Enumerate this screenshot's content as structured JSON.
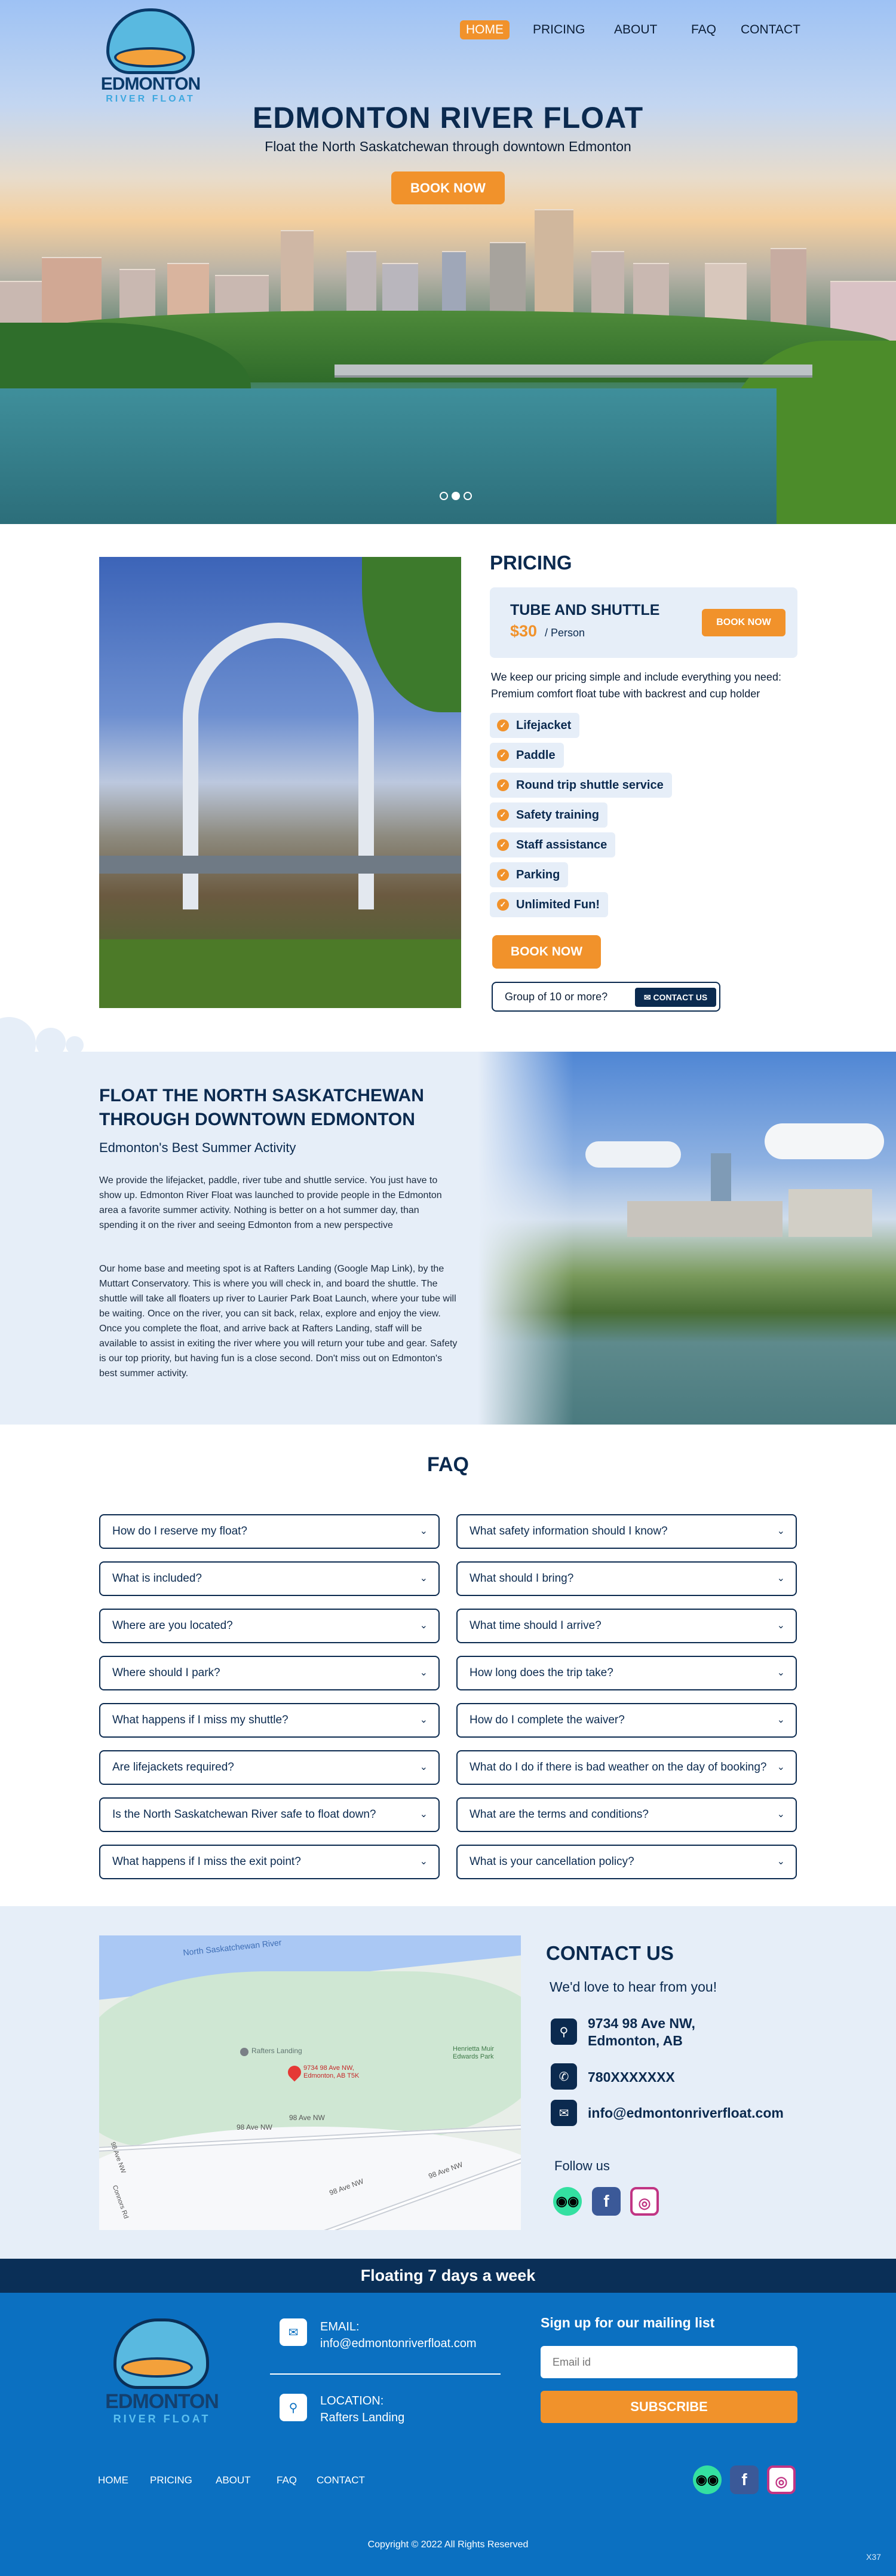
{
  "header": {
    "logo_line1": "EDMONTON",
    "logo_line2": "RIVER FLOAT",
    "nav": [
      "HOME",
      "PRICING",
      "ABOUT",
      "FAQ",
      "CONTACT"
    ]
  },
  "hero": {
    "title": "EDMONTON RIVER FLOAT",
    "subtitle": "Float the North Saskatchewan through downtown Edmonton",
    "cta": "BOOK NOW"
  },
  "pricing": {
    "title": "PRICING",
    "card_title": "TUBE AND SHUTTLE",
    "price": "$30",
    "per": "/ Person",
    "card_button": "BOOK NOW",
    "description": "We keep our pricing simple and include everything you need: Premium comfort float tube with backrest and cup holder",
    "features": [
      "Lifejacket",
      "Paddle",
      "Round trip shuttle service",
      "Safety training",
      "Staff assistance",
      "Parking",
      "Unlimited Fun!"
    ],
    "book_button": "BOOK NOW",
    "group_text": "Group of 10 or more?",
    "contact_button": "CONTACT US"
  },
  "about": {
    "title_line1": "FLOAT THE NORTH SASKATCHEWAN",
    "title_line2": "THROUGH DOWNTOWN EDMONTON",
    "subtitle": "Edmonton's Best Summer Activity",
    "para1": "We provide the lifejacket, paddle, river tube and shuttle service. You just have to show up. Edmonton River Float was launched to provide people in the Edmonton area a favorite summer activity. Nothing is better on a hot summer day, than spending it on the river and seeing Edmonton from a new perspective",
    "para2": "Our home base and meeting spot is at Rafters Landing (Google Map Link), by the Muttart Conservatory. This is where you will check in, and board the shuttle. The shuttle will take all floaters up river to Laurier Park Boat Launch, where your tube will be waiting. Once on the river, you can sit back, relax, explore and enjoy the view. Once you complete the float, and arrive back at Rafters Landing, staff will be available to assist in exiting the river where you will return your tube and gear. Safety is our top priority, but having fun is a close second. Don't miss out on Edmonton's best summer activity."
  },
  "faq": {
    "title": "FAQ",
    "left": [
      "How do I reserve my float?",
      "What is included?",
      "Where are you located?",
      "Where should I park?",
      "What happens if I miss my shuttle?",
      "Are lifejackets required?",
      "Is the North Saskatchewan River safe to float down?",
      "What happens if I miss the exit point?"
    ],
    "right": [
      "What safety information should I know?",
      "What should I bring?",
      "What time should I arrive?",
      "How long does the trip take?",
      "How do I complete the waiver?",
      "What do I do if there is bad weather on the day of booking?",
      "What are the terms and conditions?",
      "What is your cancellation policy?"
    ]
  },
  "map": {
    "river": "North Saskatchewan River",
    "place": "Rafters Landing",
    "pin": "9734 98 Ave NW, Edmonton, AB T5K",
    "road1": "98 Ave NW",
    "road2": "98 Ave NW",
    "road3": "98 Ave NW",
    "road4": "98 Ave NW",
    "side1": "98 Ave NW",
    "side2": "Connors Rd",
    "park": "Henrietta Muir Edwards Park"
  },
  "contact": {
    "title": "CONTACT US",
    "tagline": "We'd love to hear from you!",
    "address1": "9734 98 Ave NW,",
    "address2": "Edmonton, AB",
    "phone": "780XXXXXXX",
    "email": "info@edmontonriverfloat.com",
    "follow": "Follow us"
  },
  "footer": {
    "banner": "Floating 7 days a week",
    "email_label": "EMAIL:",
    "email": "info@edmontonriverfloat.com",
    "location_label": "LOCATION:",
    "location": "Rafters Landing",
    "mailing_title": "Sign up for our mailing list",
    "email_placeholder": "Email id",
    "subscribe": "SUBSCRIBE",
    "nav": [
      "HOME",
      "PRICING",
      "ABOUT",
      "FAQ",
      "CONTACT"
    ],
    "copyright": "Copyright © 2022 All Rights Reserved",
    "corner": "X37"
  },
  "colors": {
    "navy": "#0b2a4f",
    "orange": "#f1922b",
    "footer_blue": "#0b70c1",
    "banner_navy": "#0a2f57",
    "light_bg": "#e6eef8"
  }
}
